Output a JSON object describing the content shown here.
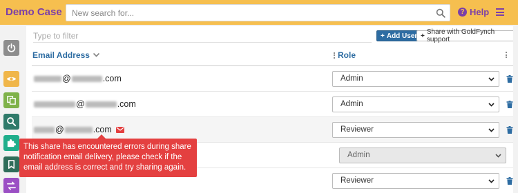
{
  "app": {
    "title": "Demo Case"
  },
  "search": {
    "placeholder": "New search for..."
  },
  "help": {
    "label": "Help"
  },
  "colors": {
    "header": "#f6bf4f",
    "brand": "#7b3fa8",
    "link": "#2d6ca2",
    "error": "#e44040"
  },
  "sidebar": {
    "items": [
      {
        "icon": "power-icon",
        "color": "#8d8d8d"
      },
      {
        "icon": "eye-icon",
        "color": "#f0b64a"
      },
      {
        "icon": "copy-icon",
        "color": "#7fb24a"
      },
      {
        "icon": "search-icon",
        "color": "#2f7a6a"
      },
      {
        "icon": "puzzle-icon",
        "color": "#1fae8b"
      },
      {
        "icon": "bookmark-icon",
        "color": "#2f6d5a"
      },
      {
        "icon": "swap-icon",
        "color": "#9b4fc4"
      }
    ]
  },
  "toolbar": {
    "filter_placeholder": "Type to filter",
    "add_user_label": "Add User",
    "share_label": "Share with GoldFynch support"
  },
  "table": {
    "columns": {
      "email": "Email Address",
      "role": "Role"
    },
    "rows": [
      {
        "email_suffix": "@",
        "email_end": ".com",
        "role": "Admin",
        "error": false,
        "disabled": false
      },
      {
        "email_suffix": "@",
        "email_end": ".com",
        "role": "Admin",
        "error": false,
        "disabled": false
      },
      {
        "email_suffix": "@",
        "email_end": ".com",
        "role": "Reviewer",
        "error": true,
        "disabled": false
      },
      {
        "email_suffix": "",
        "email_end": "",
        "role": "Admin",
        "error": false,
        "disabled": true
      },
      {
        "email_suffix": "",
        "email_end": "",
        "role": "Reviewer",
        "error": false,
        "disabled": false
      }
    ]
  },
  "tooltip": {
    "text": "This share has encountered errors during share notification email delivery, please check if the email address is correct and try sharing again."
  }
}
